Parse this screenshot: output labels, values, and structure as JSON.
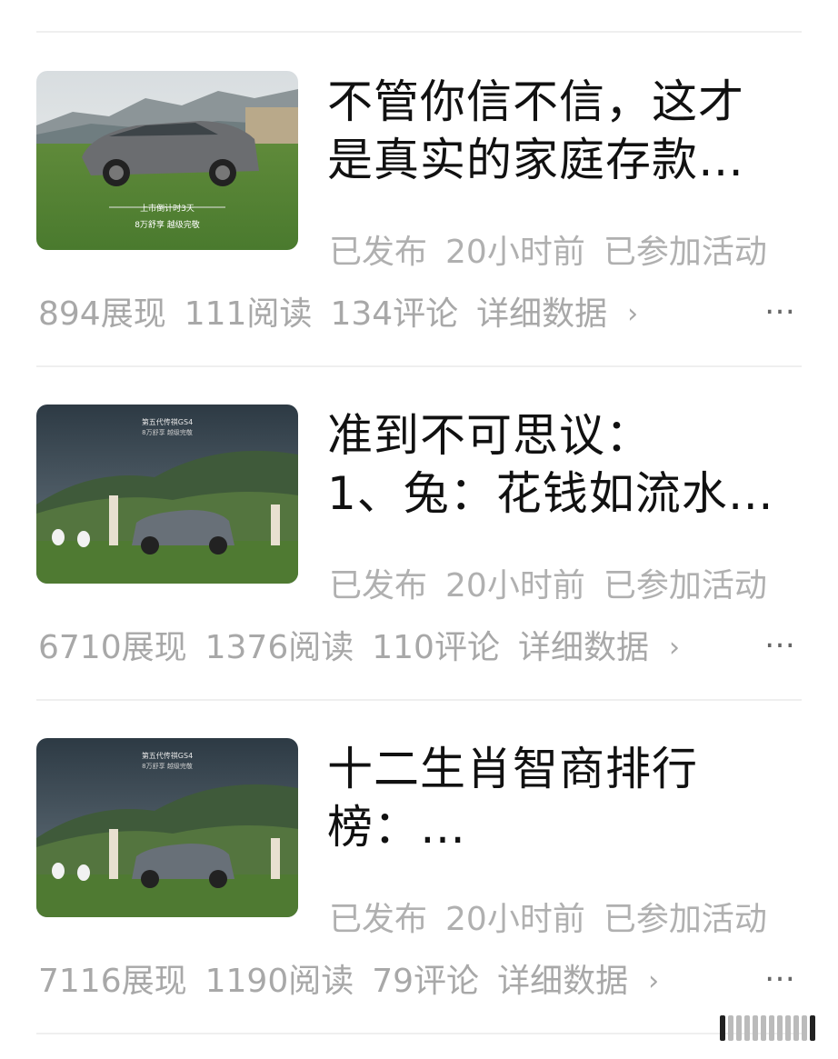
{
  "articles": [
    {
      "title_line1": "不管你信不信，这才",
      "title_line2": "是真实的家庭存款…",
      "status": "已发布",
      "time": "20小时前",
      "activity": "已参加活动",
      "impressions": "894展现",
      "reads": "111阅读",
      "comments": "134评论",
      "detail": "详细数据",
      "image_caption_top": "上市倒计时3天",
      "image_caption_bottom": "8万舒享  越级完敬"
    },
    {
      "title_line1": "准到不可思议：",
      "title_line2": "1、兔：花钱如流水…",
      "status": "已发布",
      "time": "20小时前",
      "activity": "已参加活动",
      "impressions": "6710展现",
      "reads": "1376阅读",
      "comments": "110评论",
      "detail": "详细数据",
      "image_caption_top": "第五代传祺GS4",
      "image_caption_bottom": "8万舒享 越级完敬"
    },
    {
      "title_line1": "十二生肖智商排行",
      "title_line2": "榜：…",
      "status": "已发布",
      "time": "20小时前",
      "activity": "已参加活动",
      "impressions": "7116展现",
      "reads": "1190阅读",
      "comments": "79评论",
      "detail": "详细数据",
      "image_caption_top": "第五代传祺GS4",
      "image_caption_bottom": "8万舒享 越级完敬"
    }
  ],
  "more_label": "…",
  "chevron": "›",
  "icons": {
    "more": "more-icon",
    "chevron": "chevron-right-icon",
    "watermark": "watermark-icon"
  },
  "colors": {
    "title": "#111111",
    "meta": "#b0b0b0",
    "divider": "#efefef"
  }
}
